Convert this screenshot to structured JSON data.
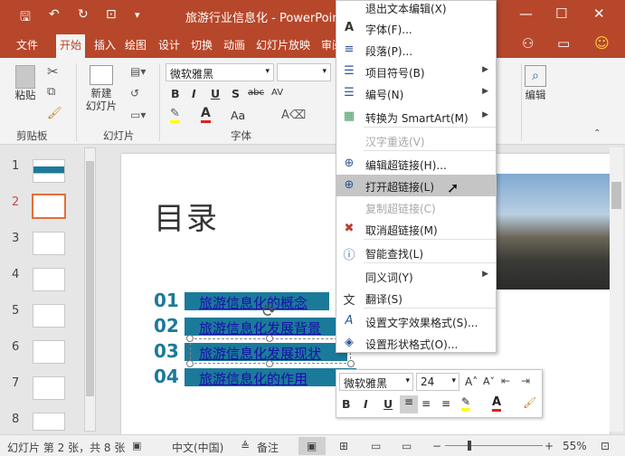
{
  "window": {
    "title": "旅游行业信息化 - PowerPoint",
    "colors": {
      "accent": "#b7472a",
      "teal": "#1b7a9a"
    }
  },
  "qat": {
    "save_icon": "save-icon",
    "undo_icon": "undo-icon",
    "redo_icon": "redo-icon",
    "present_icon": "present-icon",
    "more_icon": "more-icon"
  },
  "tabs": [
    "文件",
    "开始",
    "插入",
    "绘图",
    "设计",
    "切换",
    "动画",
    "幻灯片放映",
    "审阅"
  ],
  "ribbon": {
    "paste_label": "粘贴",
    "new_slide_label1": "新建",
    "new_slide_label2": "幻灯片",
    "font_name": "微软雅黑",
    "font_size": "",
    "group_clipboard": "剪贴板",
    "group_slides": "幻灯片",
    "group_font": "字体",
    "edit_label": "编辑",
    "bold": "B",
    "italic": "I",
    "underline": "U",
    "shadow": "S",
    "strike": "abc",
    "spacing": "AV",
    "case": "Aa"
  },
  "thumbnails": [
    "1",
    "2",
    "3",
    "4",
    "5",
    "6",
    "7",
    "8"
  ],
  "selected_slide": 2,
  "slide": {
    "title": "目录",
    "items": [
      {
        "num": "01",
        "text": "旅游信息化的概念"
      },
      {
        "num": "02",
        "text": "旅游信息化发展背景"
      },
      {
        "num": "03",
        "text": "旅游信息化发展现状"
      },
      {
        "num": "04",
        "text": "旅游信息化的作用"
      }
    ]
  },
  "context_menu": {
    "items": [
      {
        "label": "退出文本编辑(X)",
        "icon": "",
        "disabled": false
      },
      {
        "label": "字体(F)...",
        "icon": "A",
        "disabled": false
      },
      {
        "label": "段落(P)...",
        "icon": "≡",
        "disabled": false
      },
      {
        "label": "项目符号(B)",
        "icon": "☰",
        "disabled": false,
        "submenu": true
      },
      {
        "label": "编号(N)",
        "icon": "☰",
        "disabled": false,
        "submenu": true
      },
      {
        "label": "转换为 SmartArt(M)",
        "icon": "▦",
        "disabled": false,
        "submenu": true
      },
      {
        "label": "汉字重选(V)",
        "icon": "",
        "disabled": true
      },
      {
        "label": "编辑超链接(H)...",
        "icon": "⊕",
        "disabled": false
      },
      {
        "label": "打开超链接(L)",
        "icon": "⊕",
        "disabled": false,
        "highlight": true
      },
      {
        "label": "复制超链接(C)",
        "icon": "",
        "disabled": true
      },
      {
        "label": "取消超链接(M)",
        "icon": "✖",
        "disabled": false
      },
      {
        "label": "智能查找(L)",
        "icon": "ⓘ",
        "disabled": false
      },
      {
        "label": "同义词(Y)",
        "icon": "",
        "disabled": false,
        "submenu": true
      },
      {
        "label": "翻译(S)",
        "icon": "文",
        "disabled": false
      },
      {
        "label": "设置文字效果格式(S)...",
        "icon": "A",
        "disabled": false
      },
      {
        "label": "设置形状格式(O)...",
        "icon": "◈",
        "disabled": false
      }
    ]
  },
  "minibar": {
    "font_name": "微软雅黑",
    "font_size": "24",
    "bold": "B",
    "italic": "I",
    "underline": "U"
  },
  "status": {
    "slide_info": "幻灯片 第 2 张，共 8 张",
    "language": "中文(中国)",
    "notes": "备注",
    "zoom": "55%",
    "zoom_level": 0.55
  }
}
